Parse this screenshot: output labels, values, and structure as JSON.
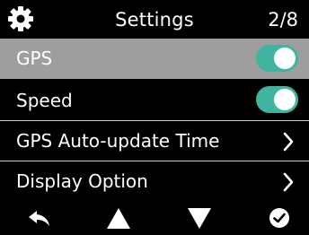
{
  "header": {
    "title": "Settings",
    "page_indicator": "2/8",
    "icon": "gear-icon"
  },
  "rows": [
    {
      "label": "GPS",
      "control": "toggle",
      "state": "on",
      "selected": true
    },
    {
      "label": "Speed",
      "control": "toggle",
      "state": "on",
      "selected": false
    },
    {
      "label": "GPS Auto-update Time",
      "control": "chevron",
      "selected": false
    },
    {
      "label": "Display Option",
      "control": "chevron",
      "selected": false
    }
  ],
  "footer": {
    "buttons": [
      "back-arrow-icon",
      "up-triangle-icon",
      "down-triangle-icon",
      "confirm-check-icon"
    ]
  },
  "colors": {
    "background": "#000000",
    "selected_row": "#9e9e9e",
    "toggle_on": "#3fb4a0",
    "divider": "#c8c8c8"
  }
}
